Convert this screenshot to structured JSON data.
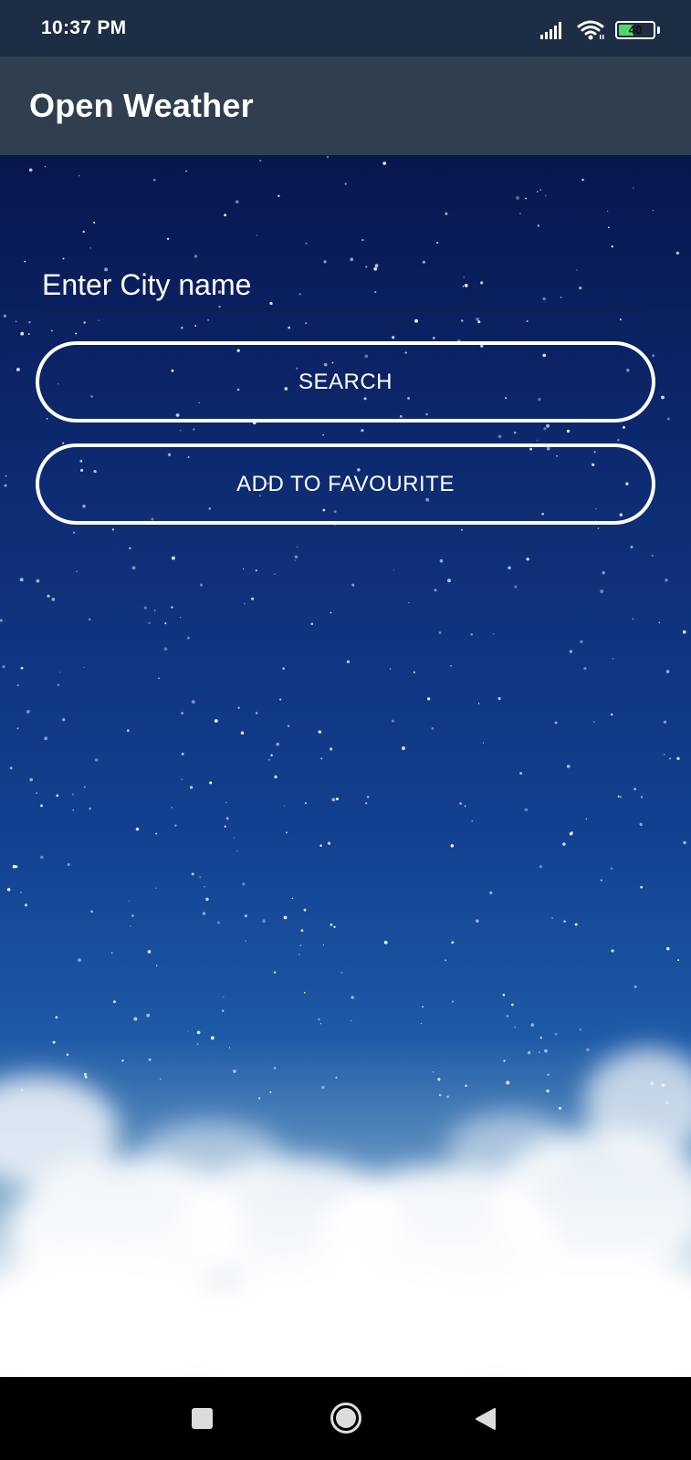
{
  "status_bar": {
    "time": "10:37 PM",
    "battery_level": "40",
    "icons": [
      "signal-icon",
      "wifi-icon",
      "battery-icon"
    ]
  },
  "app_bar": {
    "title": "Open Weather"
  },
  "search": {
    "placeholder": "Enter City name",
    "value": ""
  },
  "buttons": {
    "search_label": "SEARCH",
    "favourite_label": "ADD TO FAVOURITE"
  },
  "nav_bar": {
    "icons": [
      "recents-icon",
      "home-icon",
      "back-icon"
    ]
  },
  "colors": {
    "status_bar": "#1d2d44",
    "app_bar": "#2f3f50",
    "battery_fill": "#4cd964",
    "button_border": "#ffffff"
  }
}
